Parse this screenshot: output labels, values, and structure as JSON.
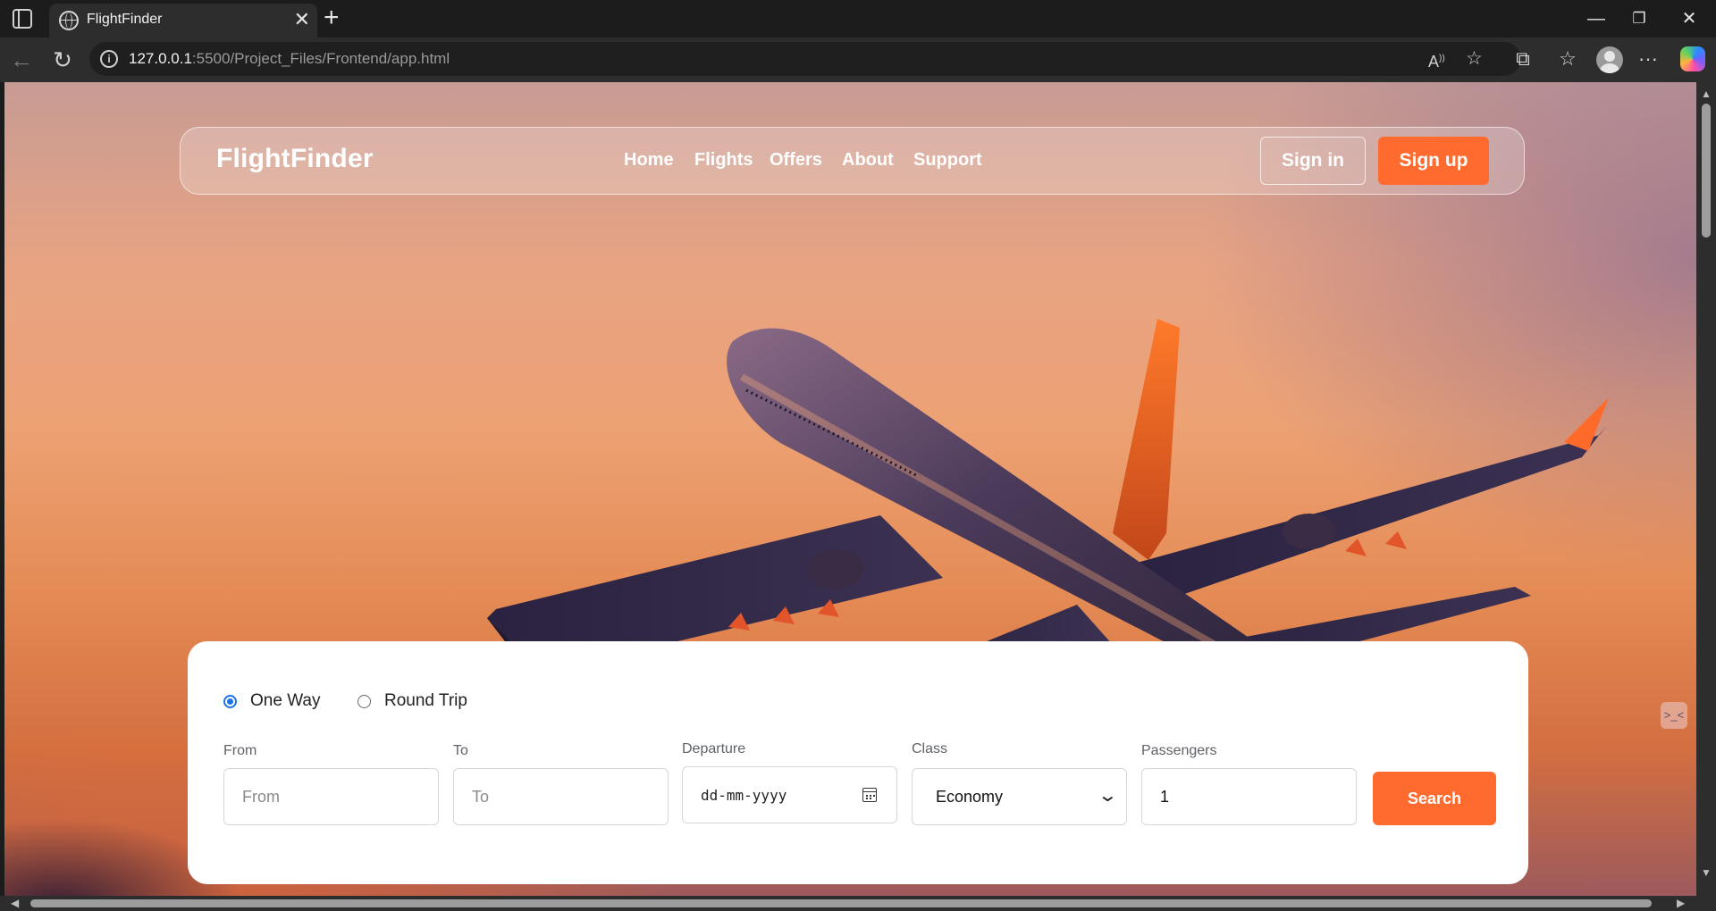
{
  "browser": {
    "tab_title": "FlightFinder",
    "url_host": "127.0.0.1",
    "url_rest": ":5500/Project_Files/Frontend/app.html",
    "icons": [
      "window-icon",
      "globe-icon",
      "close-icon",
      "plus-icon",
      "minimize-icon",
      "restore-icon",
      "back-icon",
      "reload-icon",
      "info-icon",
      "read-aloud-icon",
      "star-icon",
      "extensions-icon",
      "favorites-icon",
      "profile-icon",
      "more-icon",
      "copilot-icon"
    ]
  },
  "navbar": {
    "brand": "FlightFinder",
    "links": [
      "Home",
      "Flights",
      "Offers",
      "About",
      "Support"
    ],
    "signin": "Sign in",
    "signup": "Sign up"
  },
  "search": {
    "trip_types": [
      {
        "label": "One Way",
        "selected": true
      },
      {
        "label": "Round Trip",
        "selected": false
      }
    ],
    "from": {
      "label": "From",
      "placeholder": "From",
      "value": ""
    },
    "to": {
      "label": "To",
      "placeholder": "To",
      "value": ""
    },
    "departure": {
      "label": "Departure",
      "value": "dd-mm-yyyy"
    },
    "class": {
      "label": "Class",
      "value": "Economy"
    },
    "passengers": {
      "label": "Passengers",
      "value": "1"
    },
    "button": "Search"
  },
  "colors": {
    "accent": "#ff6a2f",
    "radio": "#1a73e8"
  }
}
